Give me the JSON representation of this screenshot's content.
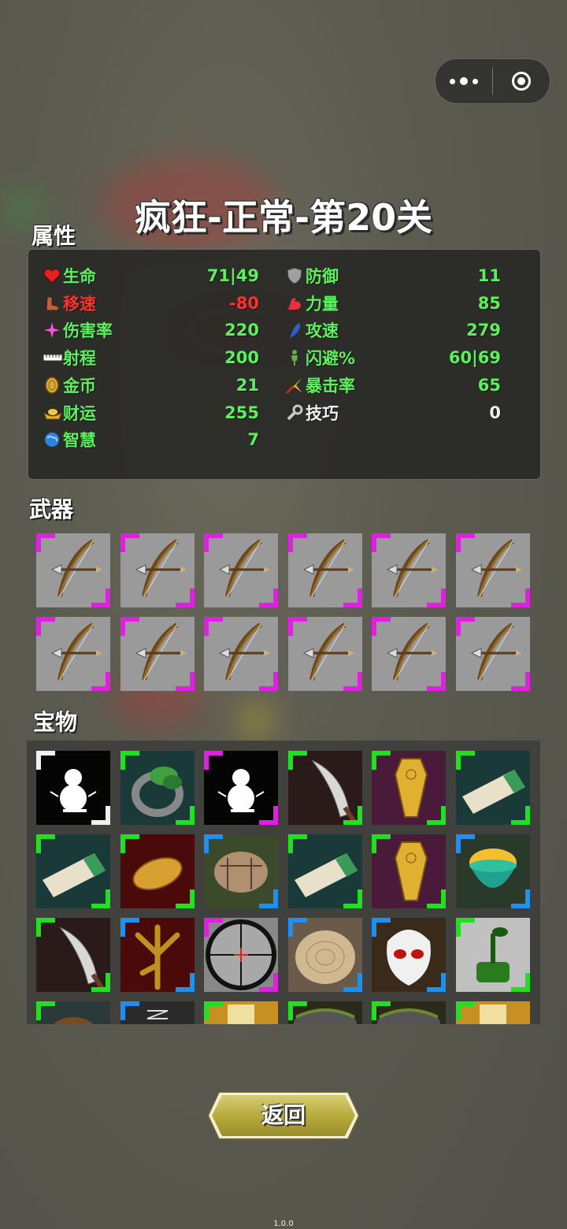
{
  "capsule": {
    "more_icon": "more-dots-icon",
    "close_icon": "target-circle-icon"
  },
  "title": "疯狂-正常-第20关",
  "sections": {
    "attributes": "属性",
    "weapons": "武器",
    "treasures": "宝物"
  },
  "stats_left": [
    {
      "icon": "heart-icon",
      "name": "生命",
      "value": "71|49",
      "color": "green"
    },
    {
      "icon": "boot-icon",
      "name": "移速",
      "value": "-80",
      "color": "red"
    },
    {
      "icon": "sparkle-icon",
      "name": "伤害率",
      "value": "220",
      "color": "green"
    },
    {
      "icon": "ruler-icon",
      "name": "射程",
      "value": "200",
      "color": "green"
    },
    {
      "icon": "coin-icon",
      "name": "金币",
      "value": "21",
      "color": "green"
    },
    {
      "icon": "gold-ingot-icon",
      "name": "财运",
      "value": "255",
      "color": "green"
    },
    {
      "icon": "brain-icon",
      "name": "智慧",
      "value": "7",
      "color": "green"
    }
  ],
  "stats_right": [
    {
      "icon": "shield-icon",
      "name": "防御",
      "value": "11",
      "color": "green"
    },
    {
      "icon": "muscle-icon",
      "name": "力量",
      "value": "85",
      "color": "green"
    },
    {
      "icon": "feather-icon",
      "name": "攻速",
      "value": "279",
      "color": "green"
    },
    {
      "icon": "figure-icon",
      "name": "闪避%",
      "value": "60|69",
      "color": "green"
    },
    {
      "icon": "crit-star-icon",
      "name": "暴击率",
      "value": "65",
      "color": "green"
    },
    {
      "icon": "wrench-icon",
      "name": "技巧",
      "value": "0",
      "color": "white"
    }
  ],
  "weapons": [
    "bow-icon",
    "bow-icon",
    "bow-icon",
    "bow-icon",
    "bow-icon",
    "bow-icon",
    "bow-icon",
    "bow-icon",
    "bow-icon",
    "bow-icon",
    "bow-icon",
    "bow-icon"
  ],
  "weapon_rarity_color": "#e020e0",
  "treasures": [
    {
      "icon": "snowman-icon",
      "rarity": "#f0f0f0"
    },
    {
      "icon": "leaf-ring-icon",
      "rarity": "#20e020"
    },
    {
      "icon": "snowman-icon",
      "rarity": "#e020e0"
    },
    {
      "icon": "knife-icon",
      "rarity": "#20e020"
    },
    {
      "icon": "coffin-icon",
      "rarity": "#20e020"
    },
    {
      "icon": "ticket-icon",
      "rarity": "#20e020"
    },
    {
      "icon": "ticket-icon",
      "rarity": "#20e020"
    },
    {
      "icon": "bread-icon",
      "rarity": "#20e020"
    },
    {
      "icon": "rock-golem-icon",
      "rarity": "#2090f0"
    },
    {
      "icon": "ticket-icon",
      "rarity": "#20e020"
    },
    {
      "icon": "coffin-icon",
      "rarity": "#20e020"
    },
    {
      "icon": "gold-pot-icon",
      "rarity": "#2090f0"
    },
    {
      "icon": "knife-icon",
      "rarity": "#20e020"
    },
    {
      "icon": "claw-icon",
      "rarity": "#2090f0"
    },
    {
      "icon": "scope-icon",
      "rarity": "#e020e0"
    },
    {
      "icon": "wood-slice-icon",
      "rarity": "#2090f0"
    },
    {
      "icon": "skull-mask-icon",
      "rarity": "#2090f0"
    },
    {
      "icon": "grinder-icon",
      "rarity": "#20e020"
    },
    {
      "icon": "nut-icon",
      "rarity": "#20e020"
    },
    {
      "icon": "spring-icon",
      "rarity": "#2090f0"
    },
    {
      "icon": "scroll-icon",
      "rarity": "#20e020"
    },
    {
      "icon": "cauldron-icon",
      "rarity": "#20e020"
    },
    {
      "icon": "cauldron-icon",
      "rarity": "#20e020"
    },
    {
      "icon": "scroll-icon",
      "rarity": "#20e020"
    }
  ],
  "back_button": "返回",
  "version": "1.0.0"
}
